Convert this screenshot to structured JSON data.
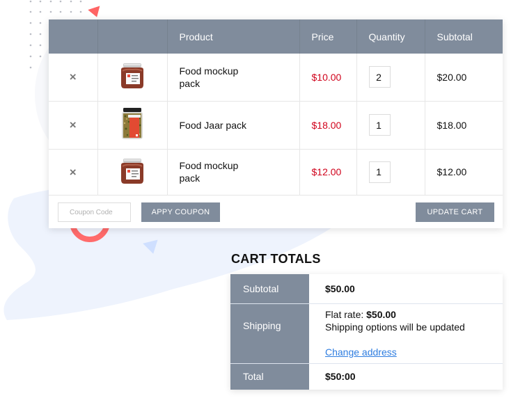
{
  "cart": {
    "headers": {
      "remove": "",
      "thumbnail": "",
      "product": "Product",
      "price": "Price",
      "quantity": "Quantity",
      "subtotal": "Subtotal"
    },
    "remove_icon": "×",
    "items": [
      {
        "name": "Food mockup pack",
        "image": "jam-jar-thumbnail",
        "price": "$10.00",
        "quantity": "2",
        "subtotal": "$20.00"
      },
      {
        "name": "Food Jaar pack",
        "image": "spice-jar-thumbnail",
        "price": "$18.00",
        "quantity": "1",
        "subtotal": "$18.00"
      },
      {
        "name": "Food mockup pack",
        "image": "jam-jar-thumbnail",
        "price": "$12.00",
        "quantity": "1",
        "subtotal": "$12.00"
      }
    ],
    "coupon_placeholder": "Coupon Code",
    "apply_coupon_label": "APPY COUPON",
    "update_cart_label": "UPDATE CART"
  },
  "totals": {
    "title": "CART TOTALS",
    "subtotal_label": "Subtotal",
    "subtotal_value": "$50.00",
    "shipping_label": "Shipping",
    "flat_rate_label": "Flat rate:",
    "flat_rate_value": "$50.00",
    "shipping_note": "Shipping options will be updated",
    "change_address": "Change address",
    "total_label": "Total",
    "total_value": "$50:00"
  },
  "colors": {
    "header_bg": "#808c9c",
    "price": "#d0021b",
    "link": "#2e7de0",
    "accent_red": "#ff6b6b",
    "accent_blue": "#cfdfff"
  }
}
